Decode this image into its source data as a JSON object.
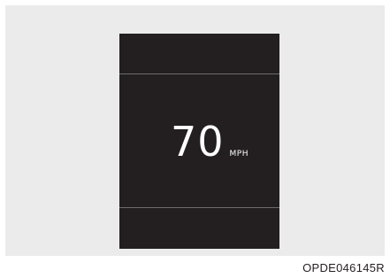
{
  "display": {
    "speed_value": "70",
    "speed_unit": "MPH"
  },
  "figure": {
    "code": "OPDE046145R"
  },
  "colors": {
    "background": "#ebebeb",
    "screen": "#231f20",
    "text": "#ffffff",
    "divider": "#6d6a6b"
  }
}
